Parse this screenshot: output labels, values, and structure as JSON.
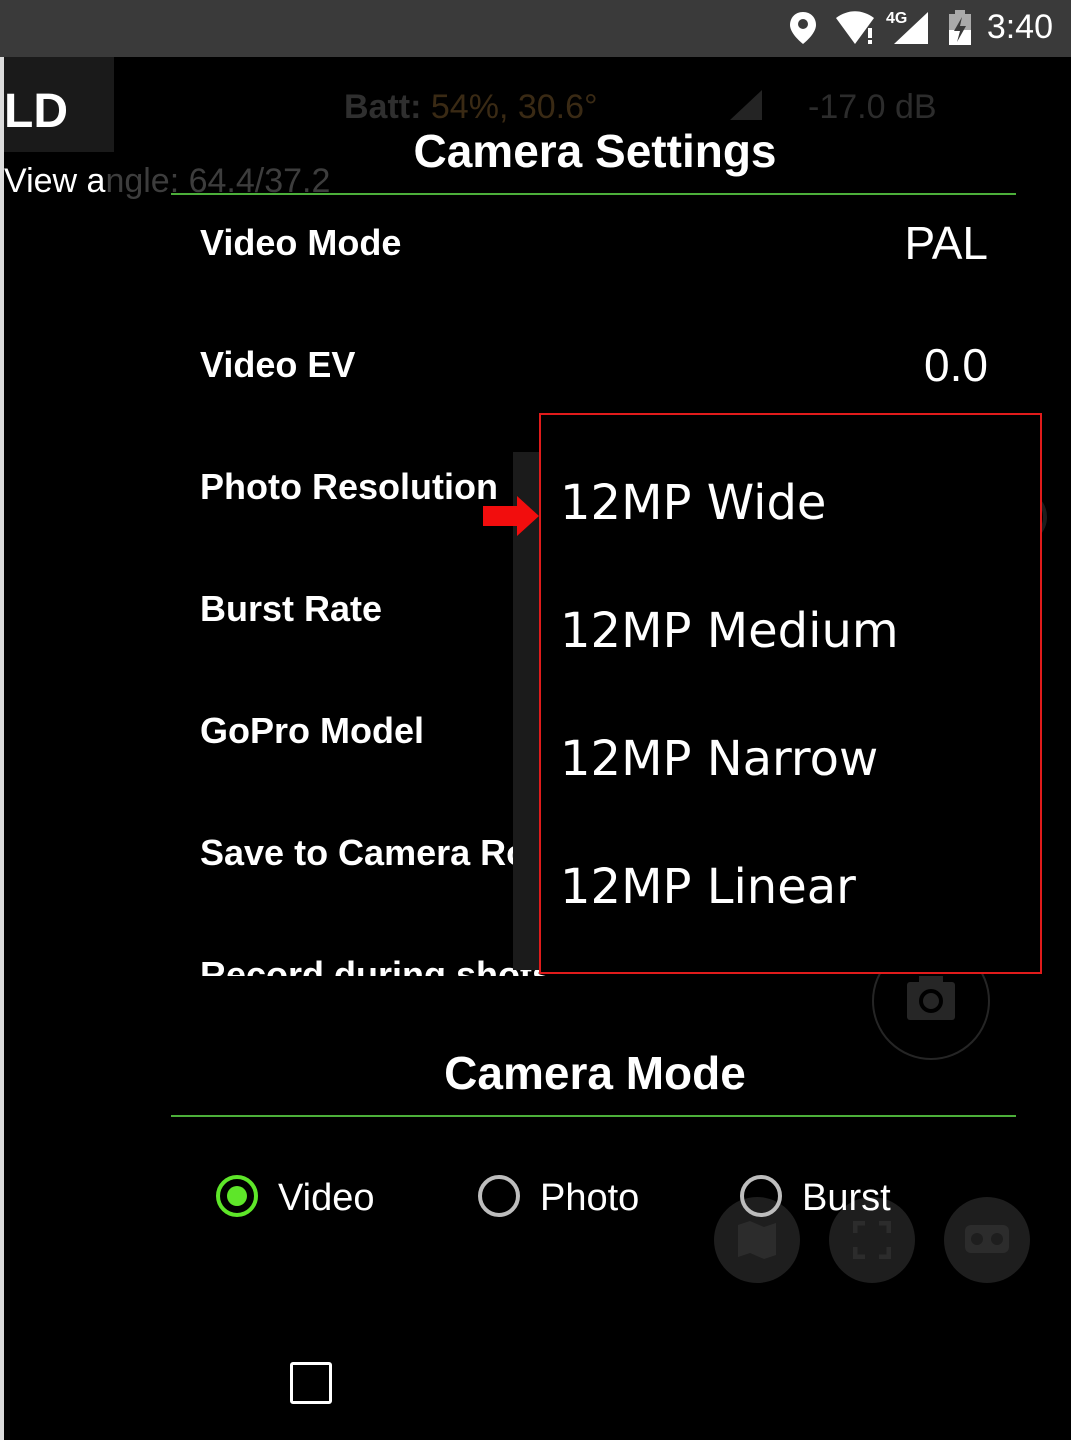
{
  "status_bar": {
    "time": "3:40",
    "network_label": "4G",
    "icons": [
      "location-pin-icon",
      "wifi-alert-icon",
      "cell-signal-icon",
      "battery-charging-icon"
    ]
  },
  "hud": {
    "title_fragment": "LD",
    "view_angle_prefix": "View a",
    "view_angle_rest": "ngle: 64.4/37.2",
    "batt_label": "Batt:",
    "batt_value": "54%, 30.6°",
    "signal_value": "-17.0 dB"
  },
  "camera_settings": {
    "title": "Camera Settings",
    "rows": [
      {
        "label": "Video Mode",
        "value": "PAL"
      },
      {
        "label": "Video EV",
        "value": "0.0"
      },
      {
        "label": "Photo Resolution",
        "value": ""
      },
      {
        "label": "Burst Rate",
        "value": ""
      },
      {
        "label": "GoPro Model",
        "value": ""
      },
      {
        "label": "Save to Camera Ro",
        "value": ""
      },
      {
        "label": "Record during shots",
        "value": ""
      }
    ]
  },
  "dropdown": {
    "options": [
      "12MP Wide",
      "12MP Medium",
      "12MP Narrow",
      "12MP Linear"
    ]
  },
  "camera_mode": {
    "title": "Camera Mode",
    "options": [
      {
        "label": "Video",
        "checked": true
      },
      {
        "label": "Photo",
        "checked": false
      },
      {
        "label": "Burst",
        "checked": false
      }
    ]
  },
  "colors": {
    "accent_green": "#5ee629",
    "divider_green": "#4caf3a",
    "highlight_red": "#e01b1b"
  }
}
